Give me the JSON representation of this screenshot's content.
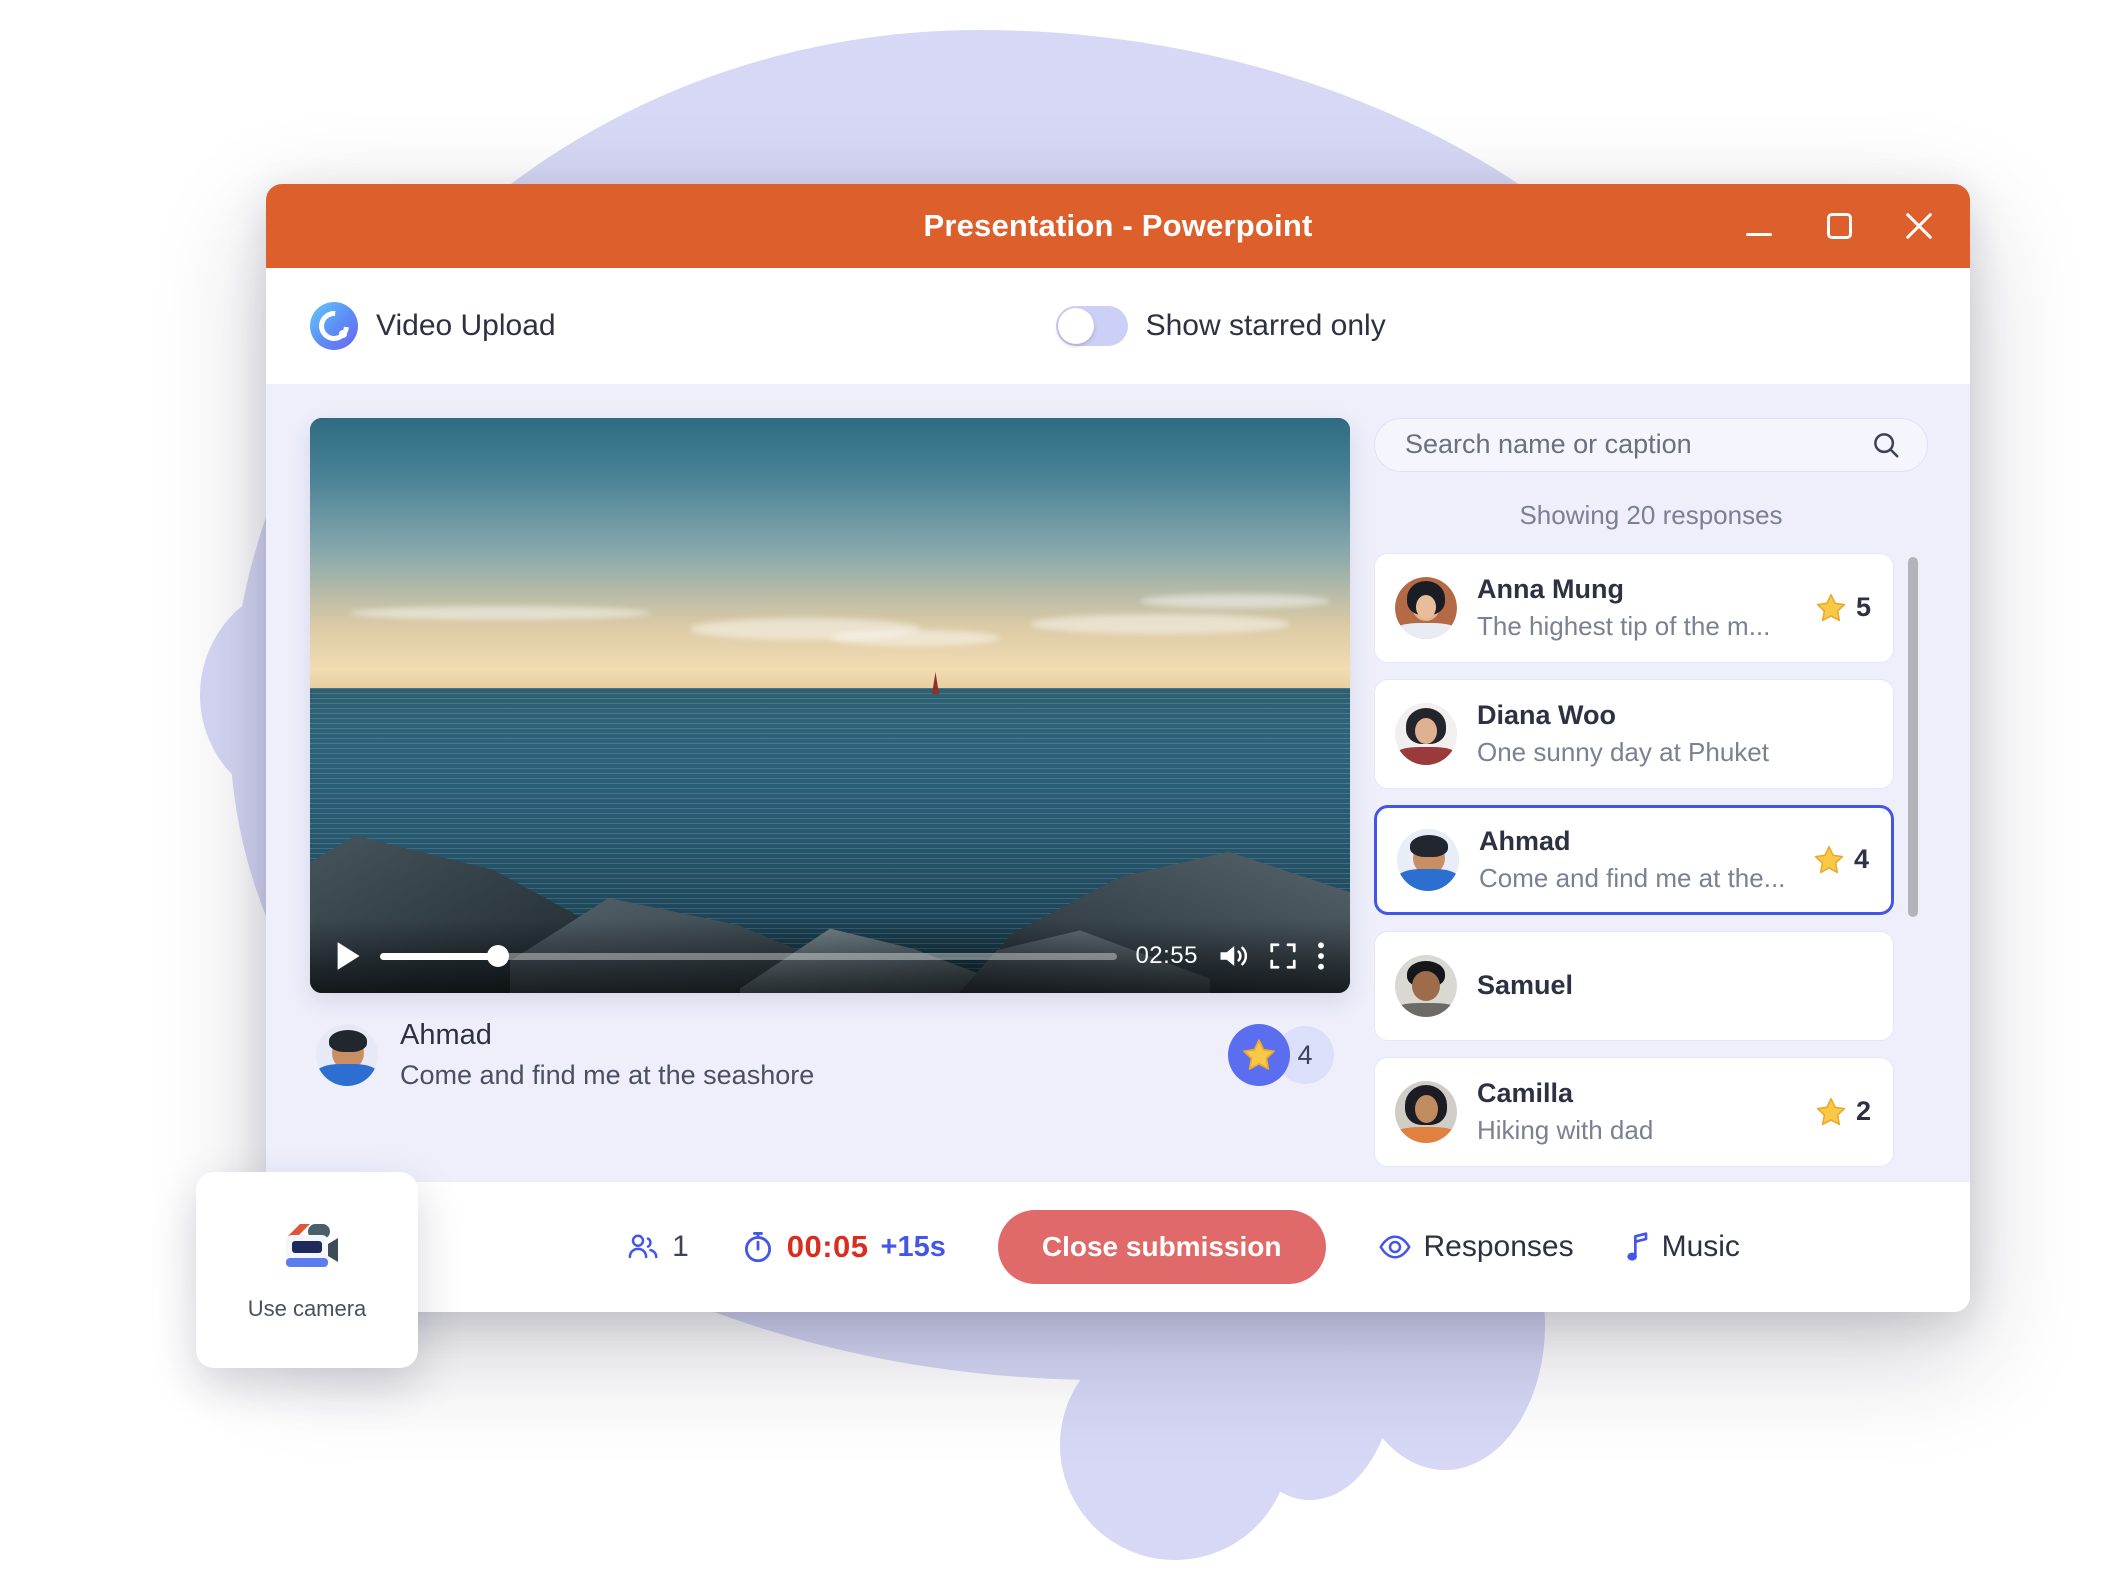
{
  "window": {
    "title": "Presentation - Powerpoint",
    "accent_color": "#dd5f2b",
    "controls": {
      "minimize": "minimize-icon",
      "maximize": "maximize-icon",
      "close": "close-icon"
    }
  },
  "header": {
    "brand_name": "Video Upload",
    "logo_icon": "classpoint-logo-icon",
    "starred_toggle": {
      "label": "Show starred only",
      "state": "off"
    }
  },
  "video": {
    "current_time": "02:55",
    "progress_percent": 16,
    "play_icon": "play-icon",
    "volume_icon": "volume-icon",
    "fullscreen_icon": "fullscreen-icon",
    "more_icon": "more-vertical-icon",
    "caption": {
      "name": "Ahmad",
      "text": "Come and find me at the seashore",
      "star_count": "4",
      "star_icon": "star-icon"
    }
  },
  "responses_panel": {
    "search": {
      "placeholder": "Search name or caption",
      "value": "",
      "icon": "search-icon"
    },
    "showing_text": "Showing 20 responses",
    "items": [
      {
        "name": "Anna Mung",
        "caption": "The highest tip of the m...",
        "stars": "5",
        "selected": false
      },
      {
        "name": "Diana Woo",
        "caption": "One sunny day at Phuket",
        "stars": "",
        "selected": false
      },
      {
        "name": "Ahmad",
        "caption": "Come and find me at the...",
        "stars": "4",
        "selected": true
      },
      {
        "name": "Samuel",
        "caption": "",
        "stars": "",
        "selected": false
      },
      {
        "name": "Camilla",
        "caption": "Hiking with dad",
        "stars": "2",
        "selected": false
      }
    ]
  },
  "toolbar": {
    "participants_icon": "people-icon",
    "participants_count": "1",
    "timer_icon": "stopwatch-icon",
    "timer_value": "00:05",
    "timer_extra": "+15s",
    "close_button": "Close submission",
    "responses_icon": "eye-icon",
    "responses_label": "Responses",
    "music_icon": "music-note-icon",
    "music_label": "Music"
  },
  "use_camera": {
    "label": "Use camera",
    "icon": "video-camera-icon"
  }
}
